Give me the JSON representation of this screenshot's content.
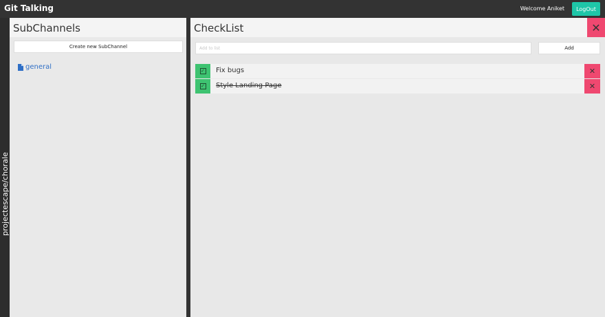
{
  "header": {
    "brand": "Git Talking",
    "welcome": "Welcome Aniket",
    "logout_label": "LogOut"
  },
  "rail": {
    "repo": "projectescape/chorale"
  },
  "subchannels": {
    "title": "SubChannels",
    "create_label": "Create new SubChannel",
    "items": [
      {
        "label": "general",
        "icon": "file-icon"
      }
    ]
  },
  "checklist": {
    "title": "CheckList",
    "close_icon": "close-icon",
    "input_placeholder": "Add to list",
    "add_label": "Add",
    "items": [
      {
        "text": "Fix bugs",
        "done": false
      },
      {
        "text": "Style Landing Page",
        "done": true
      }
    ]
  },
  "colors": {
    "topbar": "#333333",
    "accent": "#1ec6a8",
    "check_green": "#3ec371",
    "delete_red": "#ef4870",
    "link_blue": "#2f6fc6"
  }
}
